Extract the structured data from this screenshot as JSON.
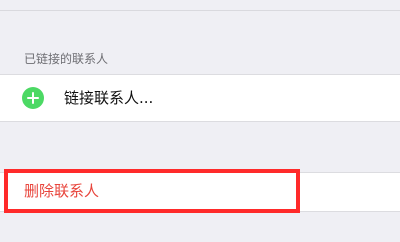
{
  "section": {
    "header": "已链接的联系人"
  },
  "link_row": {
    "label": "链接联系人...",
    "icon": "plus-circle-icon",
    "icon_color": "#4cd964"
  },
  "delete_row": {
    "label": "删除联系人",
    "color": "#e8453c"
  },
  "annotation": {
    "highlight_color": "#ff2a2a"
  }
}
